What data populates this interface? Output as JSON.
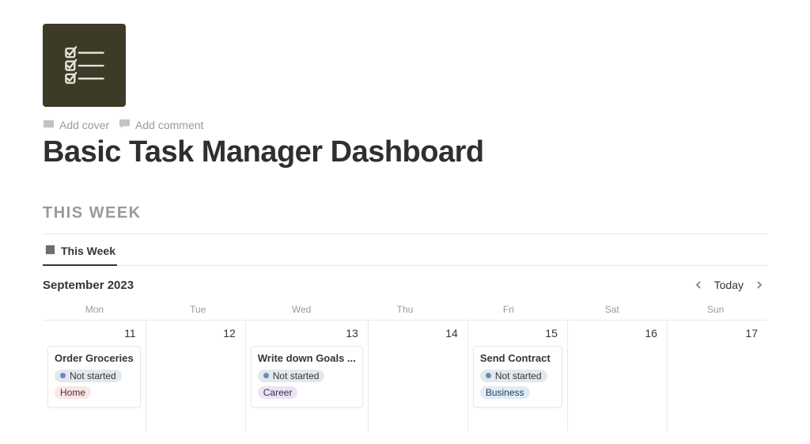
{
  "header": {
    "add_cover": "Add cover",
    "add_comment": "Add comment",
    "title": "Basic Task Manager Dashboard"
  },
  "section": {
    "heading": "THIS WEEK"
  },
  "tabs": {
    "active": "This Week"
  },
  "calendar": {
    "month_label": "September 2023",
    "today_label": "Today",
    "day_headers": [
      "Mon",
      "Tue",
      "Wed",
      "Thu",
      "Fri",
      "Sat",
      "Sun"
    ],
    "dates": [
      "11",
      "12",
      "13",
      "14",
      "15",
      "16",
      "17"
    ]
  },
  "status": {
    "not_started": "Not started"
  },
  "tags": {
    "home": "Home",
    "career": "Career",
    "business": "Business"
  },
  "cards": {
    "mon": {
      "title": "Order Groceries"
    },
    "wed": {
      "title": "Write down Goals ..."
    },
    "fri": {
      "title": "Send Contract"
    }
  }
}
